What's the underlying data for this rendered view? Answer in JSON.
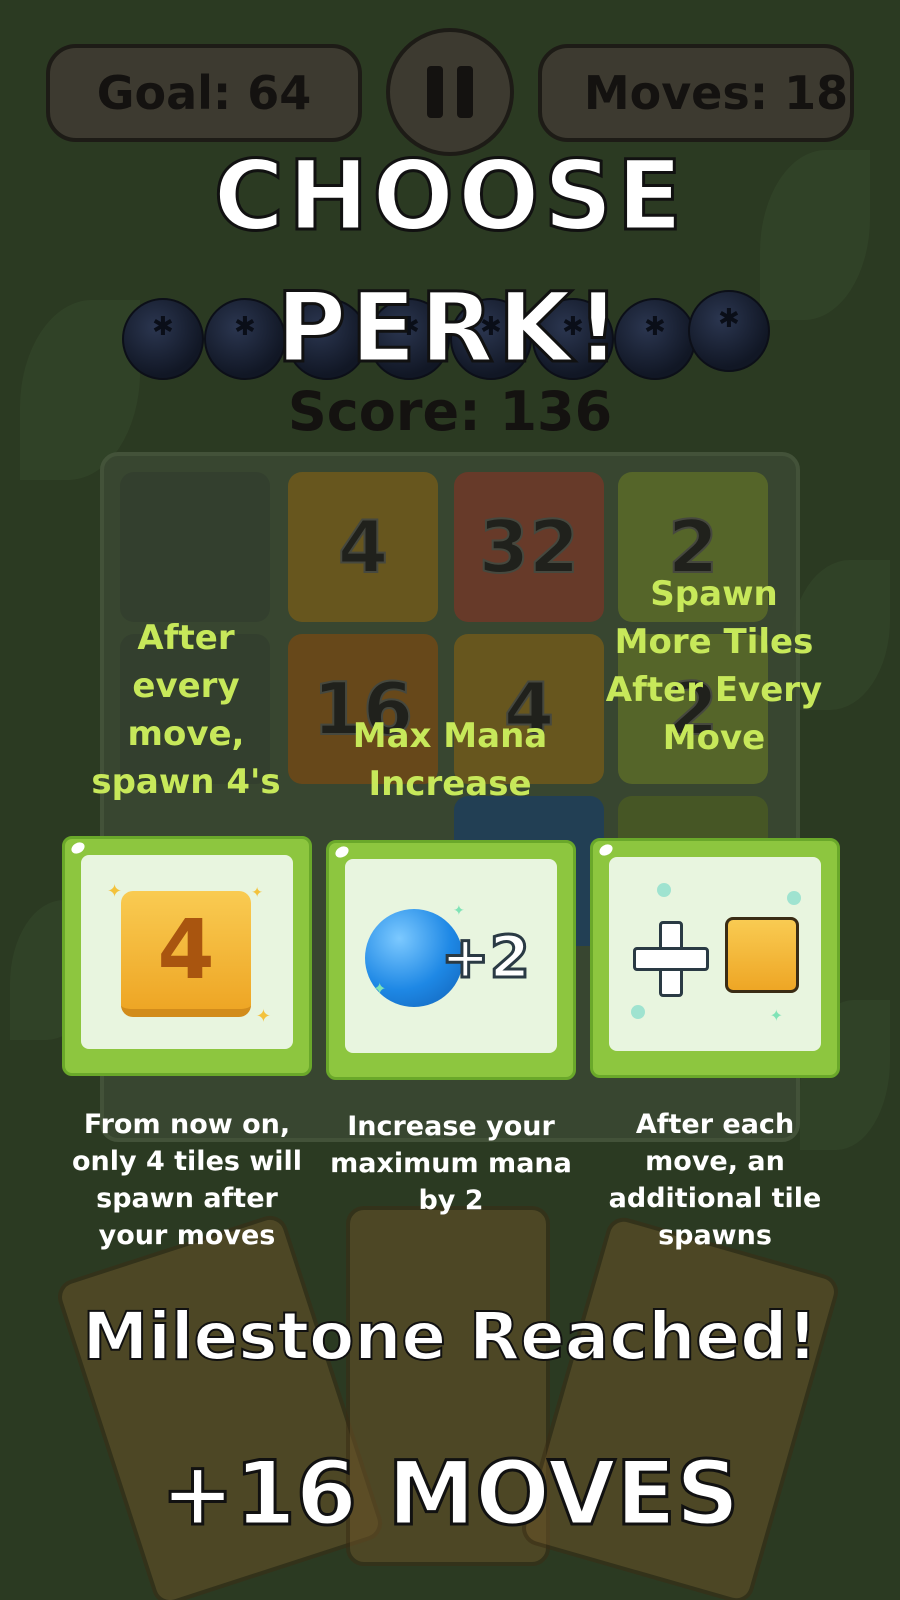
{
  "hud": {
    "goal_label": "Goal: 64",
    "moves_label": "Moves: 18",
    "pause_icon": "pause-icon"
  },
  "score_label": "Score: 136",
  "board": {
    "tiles": [
      {
        "value": "",
        "fruit": "empty"
      },
      {
        "value": "4",
        "fruit": "banana"
      },
      {
        "value": "32",
        "fruit": "strawberry"
      },
      {
        "value": "2",
        "fruit": "apple"
      },
      {
        "value": "",
        "fruit": "empty"
      },
      {
        "value": "16",
        "fruit": "orange"
      },
      {
        "value": "4",
        "fruit": "banana"
      },
      {
        "value": "2",
        "fruit": "apple"
      }
    ]
  },
  "overlay": {
    "title_line1": "CHOOSE",
    "title_line2": "PERK!",
    "perks": [
      {
        "name": "After every move, spawn 4's",
        "icon": "tile-4-icon",
        "tile_value": "4",
        "description": "From now on, only 4 tiles will spawn after your moves"
      },
      {
        "name": "Max Mana Increase",
        "icon": "mana-orb-plus-icon",
        "bonus": "+2",
        "description": "Increase your maximum mana by 2"
      },
      {
        "name": "Spawn More Tiles After Every Move",
        "icon": "plus-tile-icon",
        "description": "After each move, an additional tile spawns"
      }
    ],
    "milestone": "Milestone Reached!",
    "moves_bonus": "+16 MOVES"
  },
  "colors": {
    "background": "#2b3a22",
    "perk_card": "#8dc63f",
    "perk_name": "#c7e85a",
    "tile_gold": "#f4b733",
    "mana_blue": "#1e88e5"
  }
}
